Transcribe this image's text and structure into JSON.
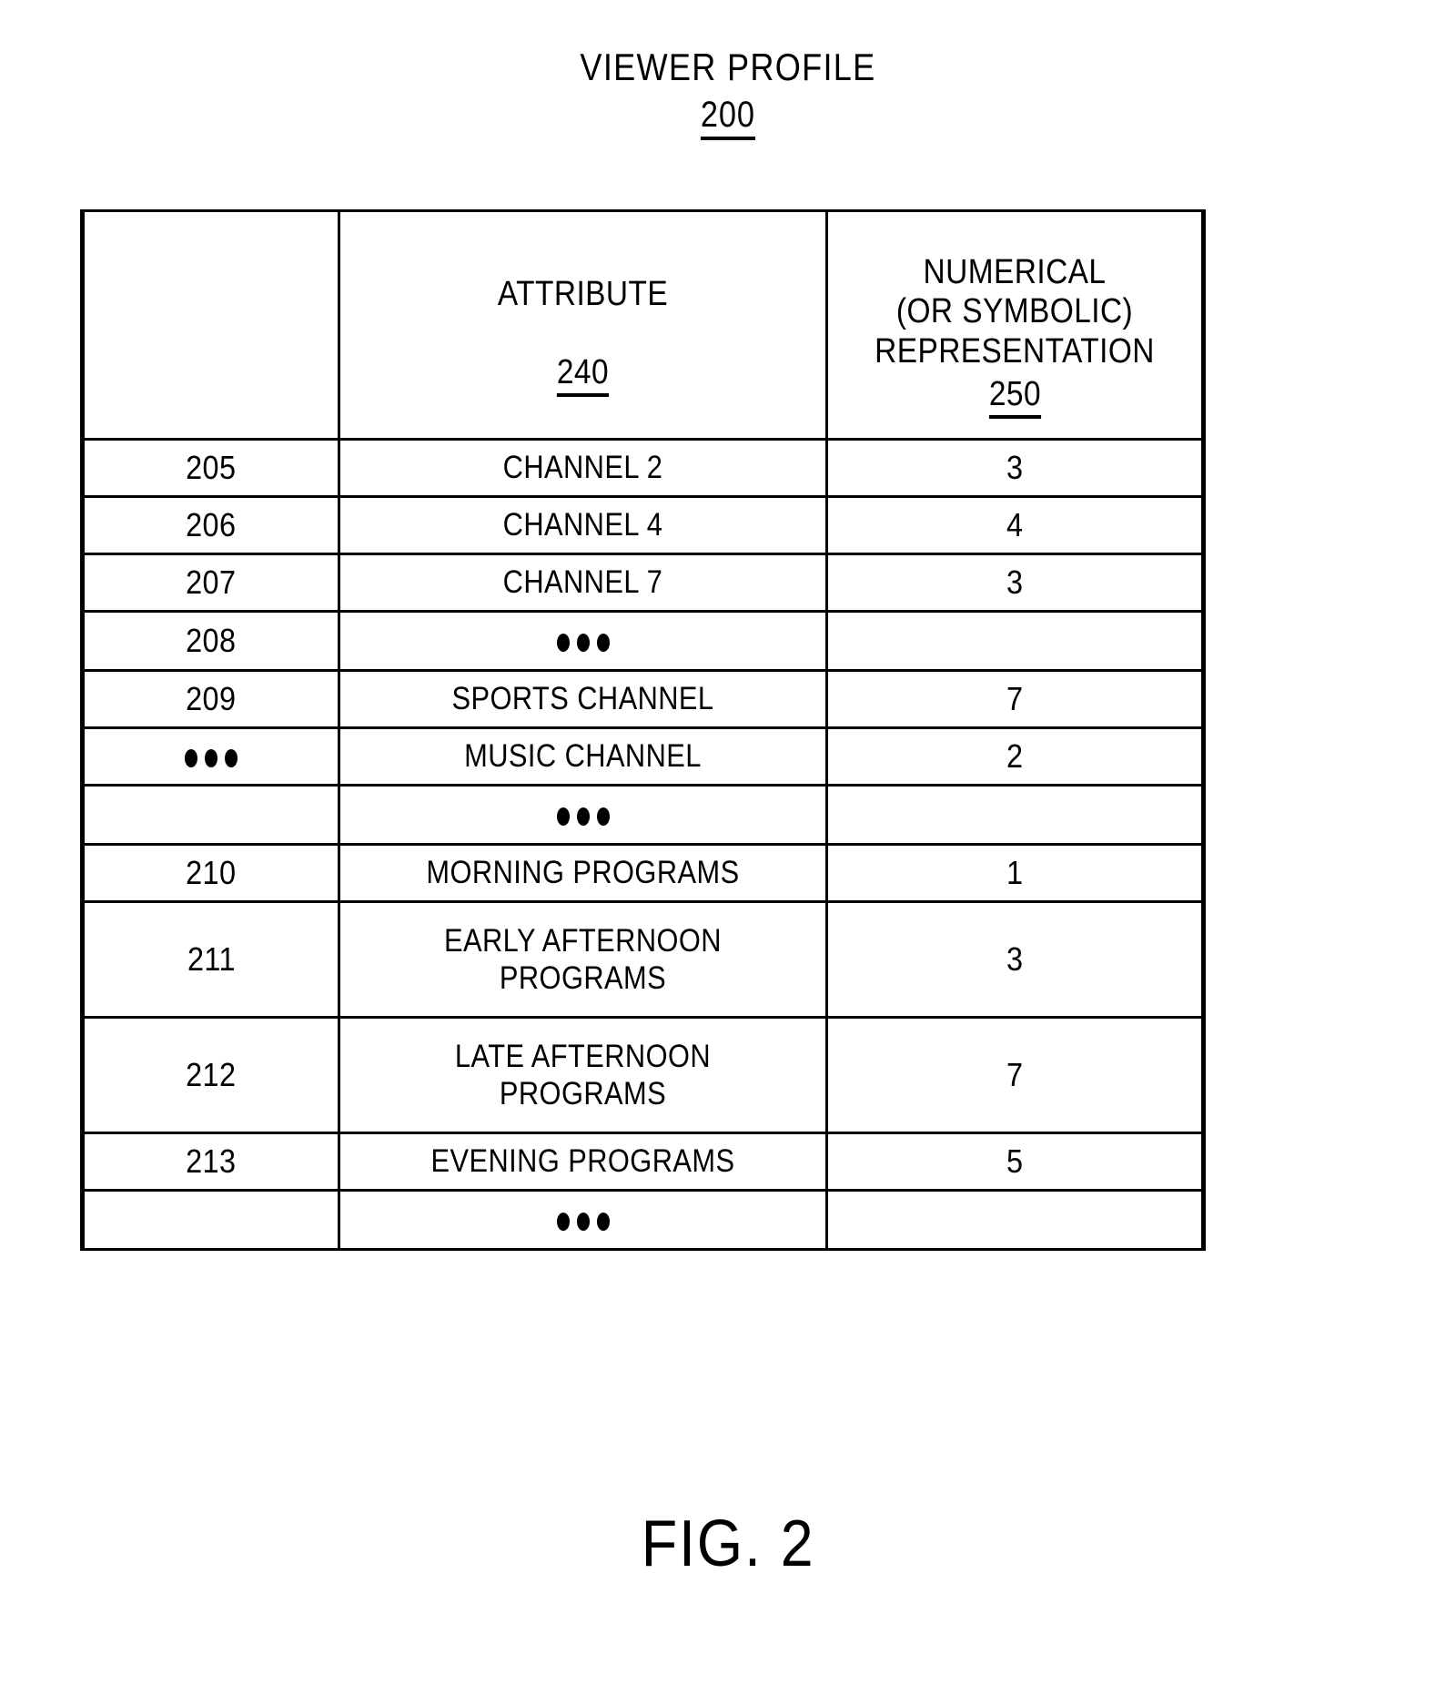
{
  "figure": {
    "title": "VIEWER PROFILE",
    "title_ref": "200",
    "caption": "FIG. 2"
  },
  "table": {
    "headers": {
      "id_column": "",
      "attribute_column": "ATTRIBUTE",
      "attribute_column_ref": "240",
      "value_column": "NUMERICAL\n(OR SYMBOLIC)\nREPRESENTATION",
      "value_column_ref": "250"
    },
    "rows": [
      {
        "ref": "205",
        "attribute": "CHANNEL 2",
        "value": "3"
      },
      {
        "ref": "206",
        "attribute": "CHANNEL 4",
        "value": "4"
      },
      {
        "ref": "207",
        "attribute": "CHANNEL 7",
        "value": "3"
      },
      {
        "ref": "208",
        "attribute": "•••",
        "value": ""
      },
      {
        "ref": "209",
        "attribute": "SPORTS CHANNEL",
        "value": "7"
      },
      {
        "ref": "•••",
        "attribute": "MUSIC CHANNEL",
        "value": "2"
      },
      {
        "ref": "",
        "attribute": "•••",
        "value": ""
      },
      {
        "ref": "210",
        "attribute": "MORNING PROGRAMS",
        "value": "1"
      },
      {
        "ref": "211",
        "attribute": "EARLY AFTERNOON\nPROGRAMS",
        "value": "3"
      },
      {
        "ref": "212",
        "attribute": "LATE AFTERNOON\nPROGRAMS",
        "value": "7"
      },
      {
        "ref": "213",
        "attribute": "EVENING PROGRAMS",
        "value": "5"
      },
      {
        "ref": "",
        "attribute": "•••",
        "value": ""
      }
    ]
  }
}
